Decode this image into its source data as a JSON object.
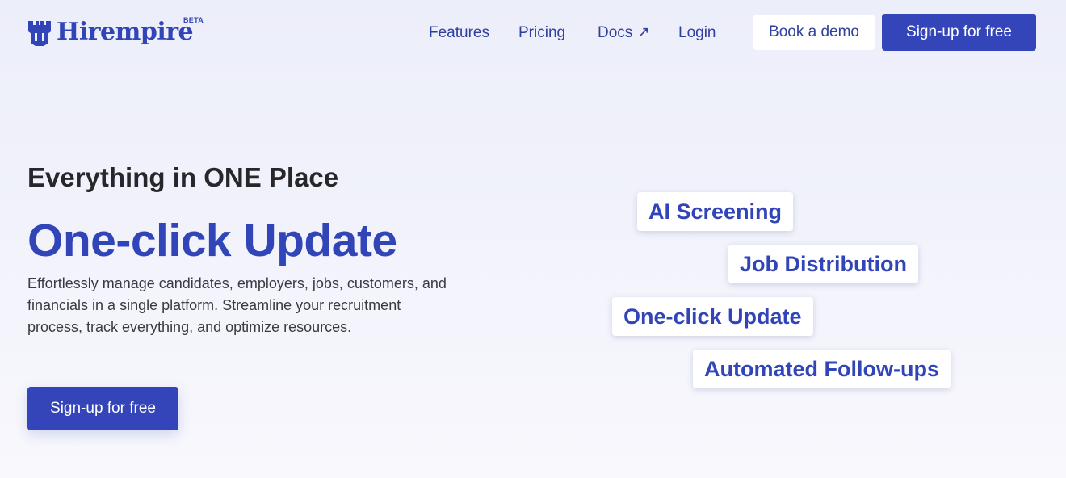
{
  "header": {
    "logo_text": "Hirempire",
    "logo_badge": "BETA",
    "nav": {
      "features": "Features",
      "pricing": "Pricing",
      "docs": "Docs ↗",
      "login": "Login"
    },
    "book_demo_label": "Book a demo",
    "signup_label": "Sign-up for free"
  },
  "hero": {
    "tagline": "Everything in ONE Place",
    "headline": "One-click Update",
    "description": "Effortlessly manage candidates, employers, jobs, customers, and financials in a single platform. Streamline your recruitment process, track everything, and optimize resources.",
    "cta_label": "Sign-up for free"
  },
  "features": [
    "AI Screening",
    "Job Distribution",
    "One-click Update",
    "Automated Follow-ups"
  ],
  "colors": {
    "brand": "#3245b8",
    "nav_text": "#2f3f9e",
    "background": "#eceef9"
  },
  "icons": {
    "logo": "castle-icon"
  }
}
